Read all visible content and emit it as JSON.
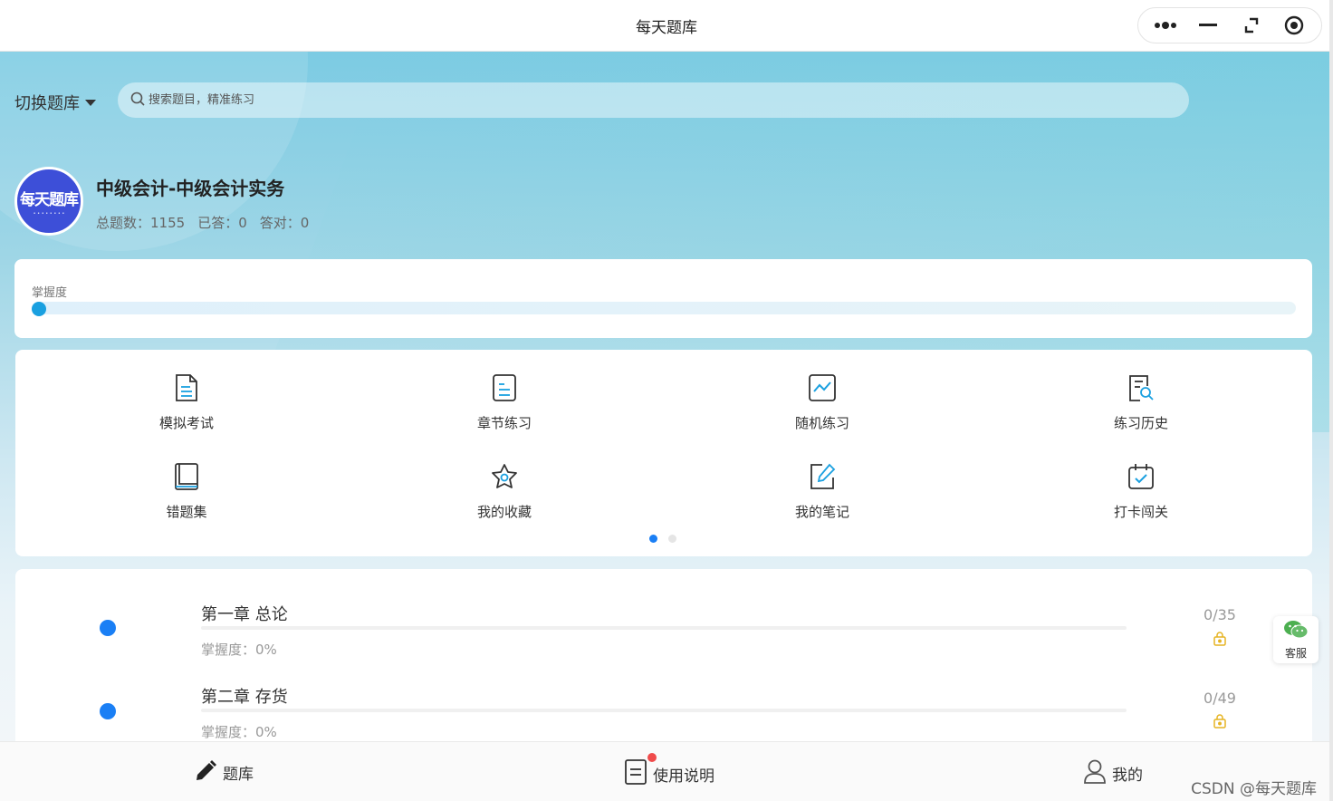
{
  "window": {
    "title": "每天题库",
    "controls": [
      "more-icon",
      "minimize-icon",
      "restore-icon",
      "close-target-icon"
    ]
  },
  "header": {
    "switch_bank_label": "切换题库",
    "search_placeholder": "搜索题目，精准练习"
  },
  "bank": {
    "logo_text": "每天题库",
    "title": "中级会计-中级会计实务",
    "stats": {
      "total": "总题数：1155",
      "answered": "已答：0",
      "correct": "答对：0"
    }
  },
  "mastery": {
    "label": "掌握度",
    "value_percent": 0
  },
  "features": [
    {
      "label": "模拟考试",
      "icon": "exam-document-icon"
    },
    {
      "label": "章节练习",
      "icon": "chapter-list-icon"
    },
    {
      "label": "随机练习",
      "icon": "random-chart-icon"
    },
    {
      "label": "练习历史",
      "icon": "history-search-icon"
    },
    {
      "label": "错题集",
      "icon": "wrong-book-icon"
    },
    {
      "label": "我的收藏",
      "icon": "star-icon"
    },
    {
      "label": "我的笔记",
      "icon": "note-edit-icon"
    },
    {
      "label": "打卡闯关",
      "icon": "calendar-check-icon"
    }
  ],
  "pager": {
    "pages": 2,
    "active": 0
  },
  "chapters": [
    {
      "title": "第一章 总论",
      "mastery": "掌握度：0%",
      "count": "0/35",
      "mastery_percent": 0
    },
    {
      "title": "第二章 存货",
      "mastery": "掌握度：0%",
      "count": "0/49",
      "mastery_percent": 0
    }
  ],
  "service": {
    "label": "客服",
    "icon": "wechat-icon"
  },
  "tabbar": {
    "tabs": [
      {
        "label": "题库",
        "icon": "pencil-icon",
        "active": true
      },
      {
        "label": "使用说明",
        "icon": "document-icon",
        "badge": true
      },
      {
        "label": "我的",
        "icon": "user-icon"
      }
    ],
    "watermark": "CSDN @每天题库"
  },
  "colors": {
    "accent": "#1a7ff5",
    "lock": "#e6b422",
    "badge": "#f04b4b",
    "logo_bg": "#3d4fd8"
  }
}
